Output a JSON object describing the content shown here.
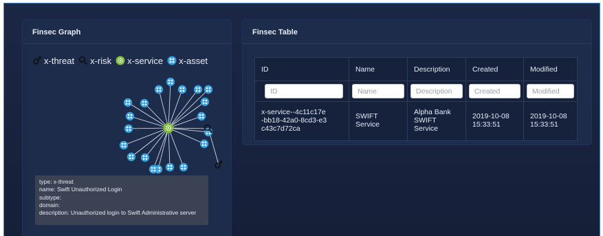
{
  "graph_panel": {
    "title": "Finsec Graph",
    "legend": [
      {
        "icon": "male-symbol-icon",
        "label": "x-threat"
      },
      {
        "icon": "magnifier-risk-icon",
        "label": "x-risk"
      },
      {
        "icon": "gear-service-icon",
        "label": "x-service"
      },
      {
        "icon": "asset-node-icon",
        "label": "x-asset"
      }
    ],
    "tooltip": {
      "type": "type: x-threat",
      "name": "name: Swift Unauthorized Login",
      "subtype": "subtype:",
      "domain": "domain:",
      "description": "description: Unauthorized login to Swift Administrative server"
    },
    "colors": {
      "asset": "#2f9fe0",
      "service": "#7ebd3a",
      "threat": "#111111",
      "link": "#e8ecf4"
    }
  },
  "table_panel": {
    "title": "Finsec Table",
    "columns": [
      "ID",
      "Name",
      "Description",
      "Created",
      "Modified"
    ],
    "filters": {
      "id": "ID",
      "name": "Name",
      "description": "Description",
      "created": "Created",
      "modified": "Modified"
    },
    "rows": [
      {
        "id": "x-service--4c11c17e-bb18-42a0-8cd3-e3c43c7d72ca",
        "name": "SWIFT Service",
        "description": "Alpha Bank SWIFT Service",
        "created": "2019-10-08 15:33:51",
        "modified": "2019-10-08 15:33:51"
      }
    ]
  }
}
